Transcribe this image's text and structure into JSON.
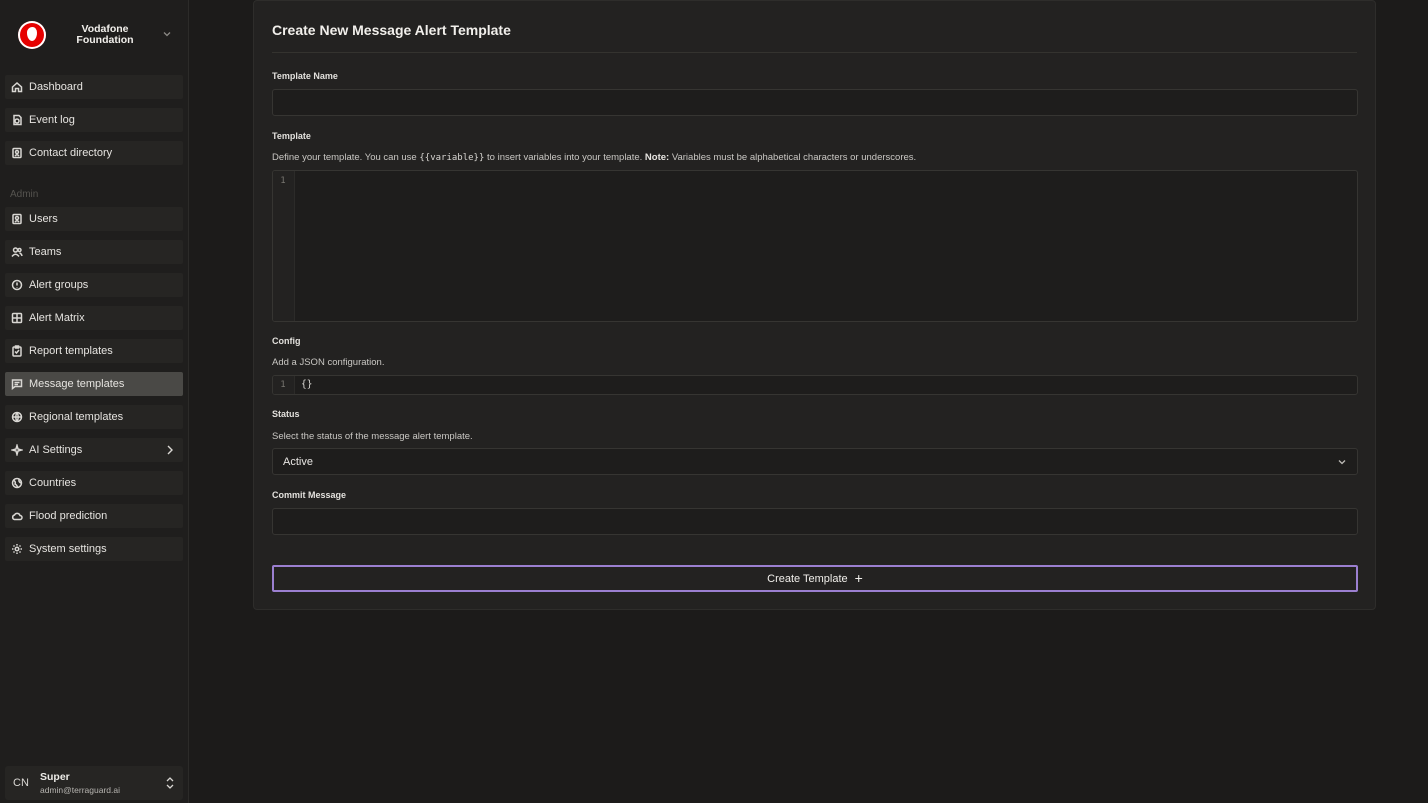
{
  "brand": {
    "name_line1": "Vodafone",
    "name_line2": "Foundation"
  },
  "nav": {
    "main": [
      {
        "label": "Dashboard",
        "icon": "home-icon"
      },
      {
        "label": "Event log",
        "icon": "event-log-icon"
      },
      {
        "label": "Contact directory",
        "icon": "contact-icon"
      }
    ],
    "admin_label": "Admin",
    "admin": [
      {
        "label": "Users",
        "icon": "user-icon"
      },
      {
        "label": "Teams",
        "icon": "teams-icon"
      },
      {
        "label": "Alert groups",
        "icon": "alert-group-icon"
      },
      {
        "label": "Alert Matrix",
        "icon": "matrix-icon"
      },
      {
        "label": "Report templates",
        "icon": "report-icon"
      },
      {
        "label": "Message templates",
        "icon": "message-icon"
      },
      {
        "label": "Regional templates",
        "icon": "globe-icon"
      },
      {
        "label": "AI Settings",
        "icon": "sparkles-icon"
      },
      {
        "label": "Countries",
        "icon": "globe-alt-icon"
      },
      {
        "label": "Flood prediction",
        "icon": "cloud-icon"
      },
      {
        "label": "System settings",
        "icon": "gear-icon"
      }
    ],
    "active": "Message templates"
  },
  "user": {
    "initials": "CN",
    "name": "Super",
    "email": "admin@terraguard.ai"
  },
  "form": {
    "title": "Create New Message Alert Template",
    "template_name_label": "Template Name",
    "template_name_value": "",
    "template_label": "Template",
    "template_help_pre": "Define your template. You can use ",
    "template_help_code": "{{variable}}",
    "template_help_mid": " to insert variables into your template. ",
    "template_help_note": "Note:",
    "template_help_post": " Variables must be alphabetical characters or underscores.",
    "template_line": "1",
    "config_label": "Config",
    "config_help": "Add a JSON configuration.",
    "config_line": "1",
    "config_value": "{}",
    "status_label": "Status",
    "status_help": "Select the status of the message alert template.",
    "status_value": "Active",
    "commit_label": "Commit Message",
    "commit_value": "",
    "submit_label": "Create Template",
    "submit_icon": "+"
  },
  "colors": {
    "accent": "#9b7fd0",
    "active_nav": "#4a4946",
    "brand": "#e60000"
  }
}
